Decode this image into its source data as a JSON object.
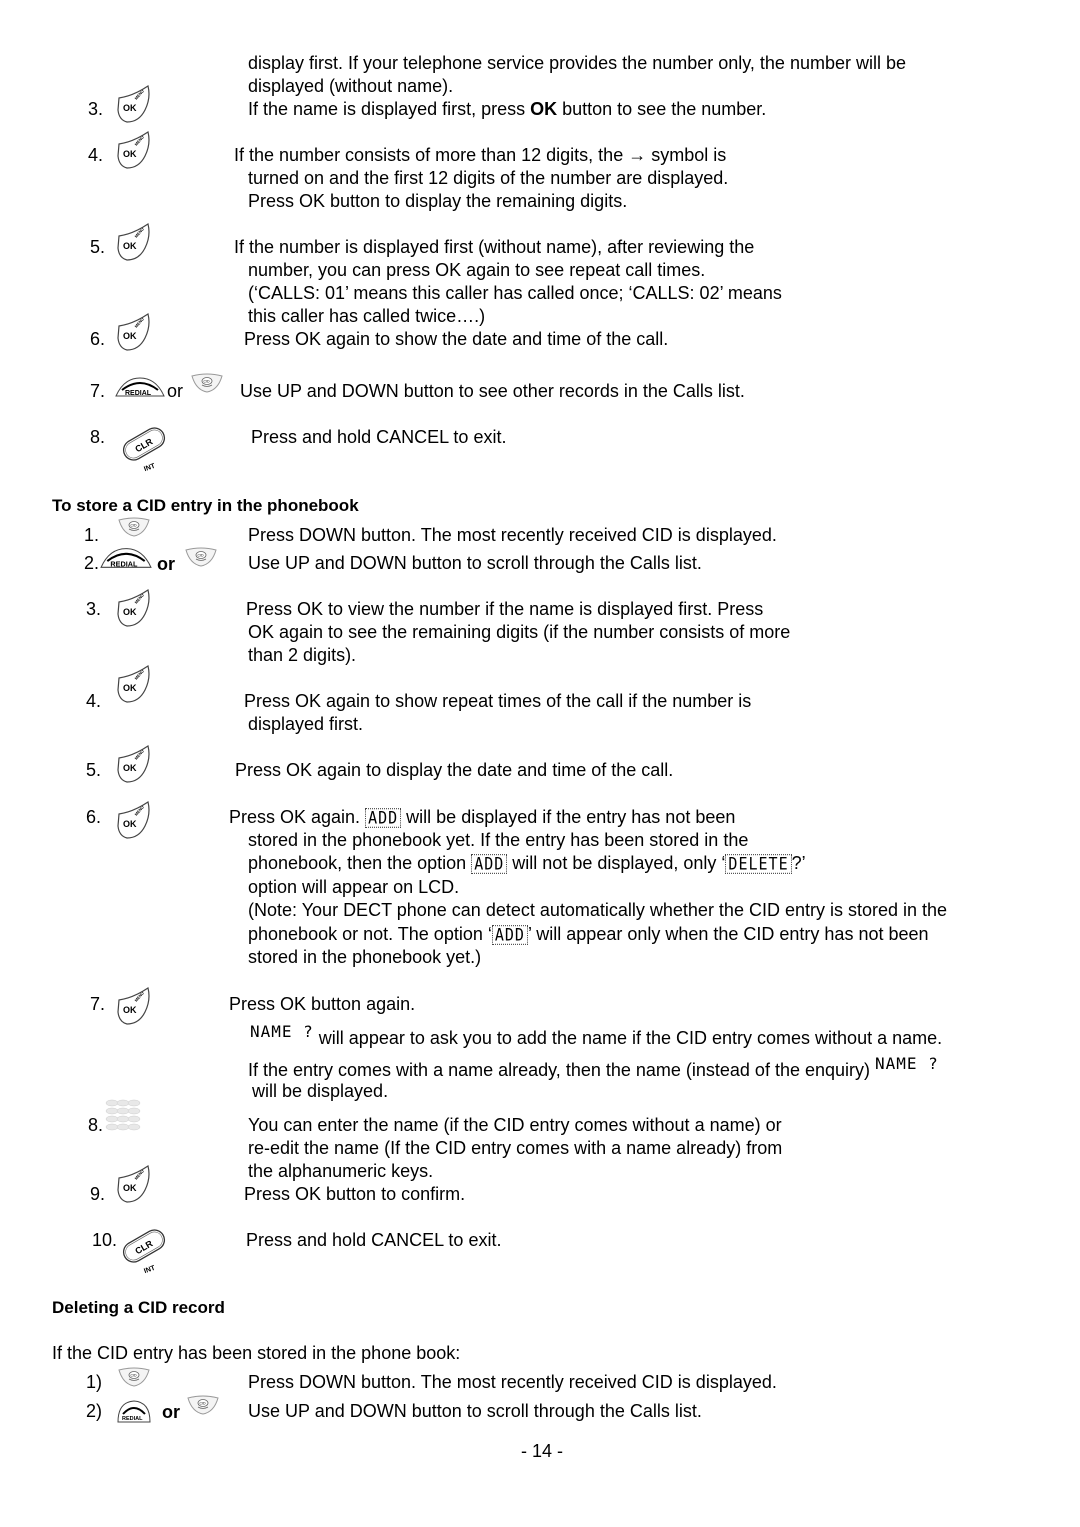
{
  "page_number": "- 14 -",
  "intro": {
    "line1": "display first.  If your telephone service provides the number only, the number will be",
    "line2": "displayed (without name)."
  },
  "review_steps": [
    {
      "num": "3.",
      "icon": "ok-menu-key",
      "lines": [
        "If the name is displayed first, press ",
        "OK",
        " button to see the number."
      ]
    },
    {
      "num": "4.",
      "icon": "ok-menu-key",
      "lines": [
        "If the number consists of more than 12 digits, the → symbol is",
        "turned on and the first 12 digits of the number are displayed.",
        "Press OK button to display the remaining digits."
      ]
    },
    {
      "num": "5.",
      "icon": "ok-menu-key",
      "lines": [
        "If the number is displayed first (without name), after reviewing the",
        "number, you can press OK again to see repeat call times.",
        "(‘CALLS: 01’ means this caller has called once; ‘CALLS: 02’ means",
        "this caller has called twice….)"
      ]
    },
    {
      "num": "6.",
      "icon": "ok-menu-key",
      "lines": [
        "Press OK again to show the date and time of the call."
      ]
    },
    {
      "num": "7.",
      "icon": "redial-or-cid",
      "or": "or",
      "lines": [
        "Use UP and DOWN button to see other records in the Calls list."
      ]
    },
    {
      "num": "8.",
      "icon": "clr-int-key",
      "lines": [
        "Press and hold CANCEL to exit."
      ]
    }
  ],
  "store_section": {
    "heading": "To store a CID entry in the phonebook",
    "steps": [
      {
        "num": "1.",
        "text": "Press DOWN button.   The most recently received CID is displayed."
      },
      {
        "num": "2.",
        "or": "or",
        "text": "Use UP and DOWN button to scroll through the Calls list."
      },
      {
        "num": "3.",
        "lines": [
          "Press OK to view the number if the name is displayed first.  Press",
          "OK again to see the remaining digits (if the number consists of more",
          "than 2 digits)."
        ]
      },
      {
        "num": "4.",
        "lines": [
          "Press OK again to show repeat times of the call if the number is",
          "displayed first."
        ]
      },
      {
        "num": "5.",
        "text": "Press OK again to display the date and time of the call."
      },
      {
        "num": "6.",
        "lines": [
          "Press OK again. ",
          " will be displayed if the entry has not been",
          "stored in the phonebook yet.    If the entry has been stored in the",
          "phonebook, then the option ",
          " will not be displayed, only ‘",
          "?’",
          "option will appear on LCD.",
          "(Note: Your DECT phone can detect automatically whether the CID entry is stored in the",
          "phonebook or not.   The option ‘",
          "’ will appear only when the CID entry has not been",
          "stored in the phonebook yet.)"
        ]
      },
      {
        "num": "7.",
        "lines": [
          "Press OK button again.",
          " will appear to ask you to add the name if the CID entry comes without a name.",
          "If the entry comes with a name already, then the name (instead of the enquiry) ",
          "will be displayed."
        ]
      },
      {
        "num": "8.",
        "lines": [
          "You can enter the name (if the CID entry comes without a name) or",
          "re-edit the name (If the CID entry comes with a name already) from",
          "the alphanumeric keys."
        ]
      },
      {
        "num": "9.",
        "text": "Press OK button to confirm."
      },
      {
        "num": "10.",
        "text": "Press and hold CANCEL to exit."
      }
    ]
  },
  "lcd": {
    "add": "ADD",
    "delete": "DELETE",
    "name": "NAME ?"
  },
  "delete_section": {
    "heading": "Deleting a CID record",
    "intro": "If the CID entry has been stored in the phone book:",
    "steps": [
      {
        "num": "1)",
        "text": "Press DOWN button.   The most recently received CID is displayed."
      },
      {
        "num": "2)",
        "or": "or",
        "text": "Use UP and DOWN button to scroll through the Calls list."
      }
    ]
  },
  "key_labels": {
    "ok": "OK",
    "menu": "MENU",
    "redial": "REDIAL",
    "cid": "CID",
    "clr": "CLR",
    "int": "INT"
  }
}
